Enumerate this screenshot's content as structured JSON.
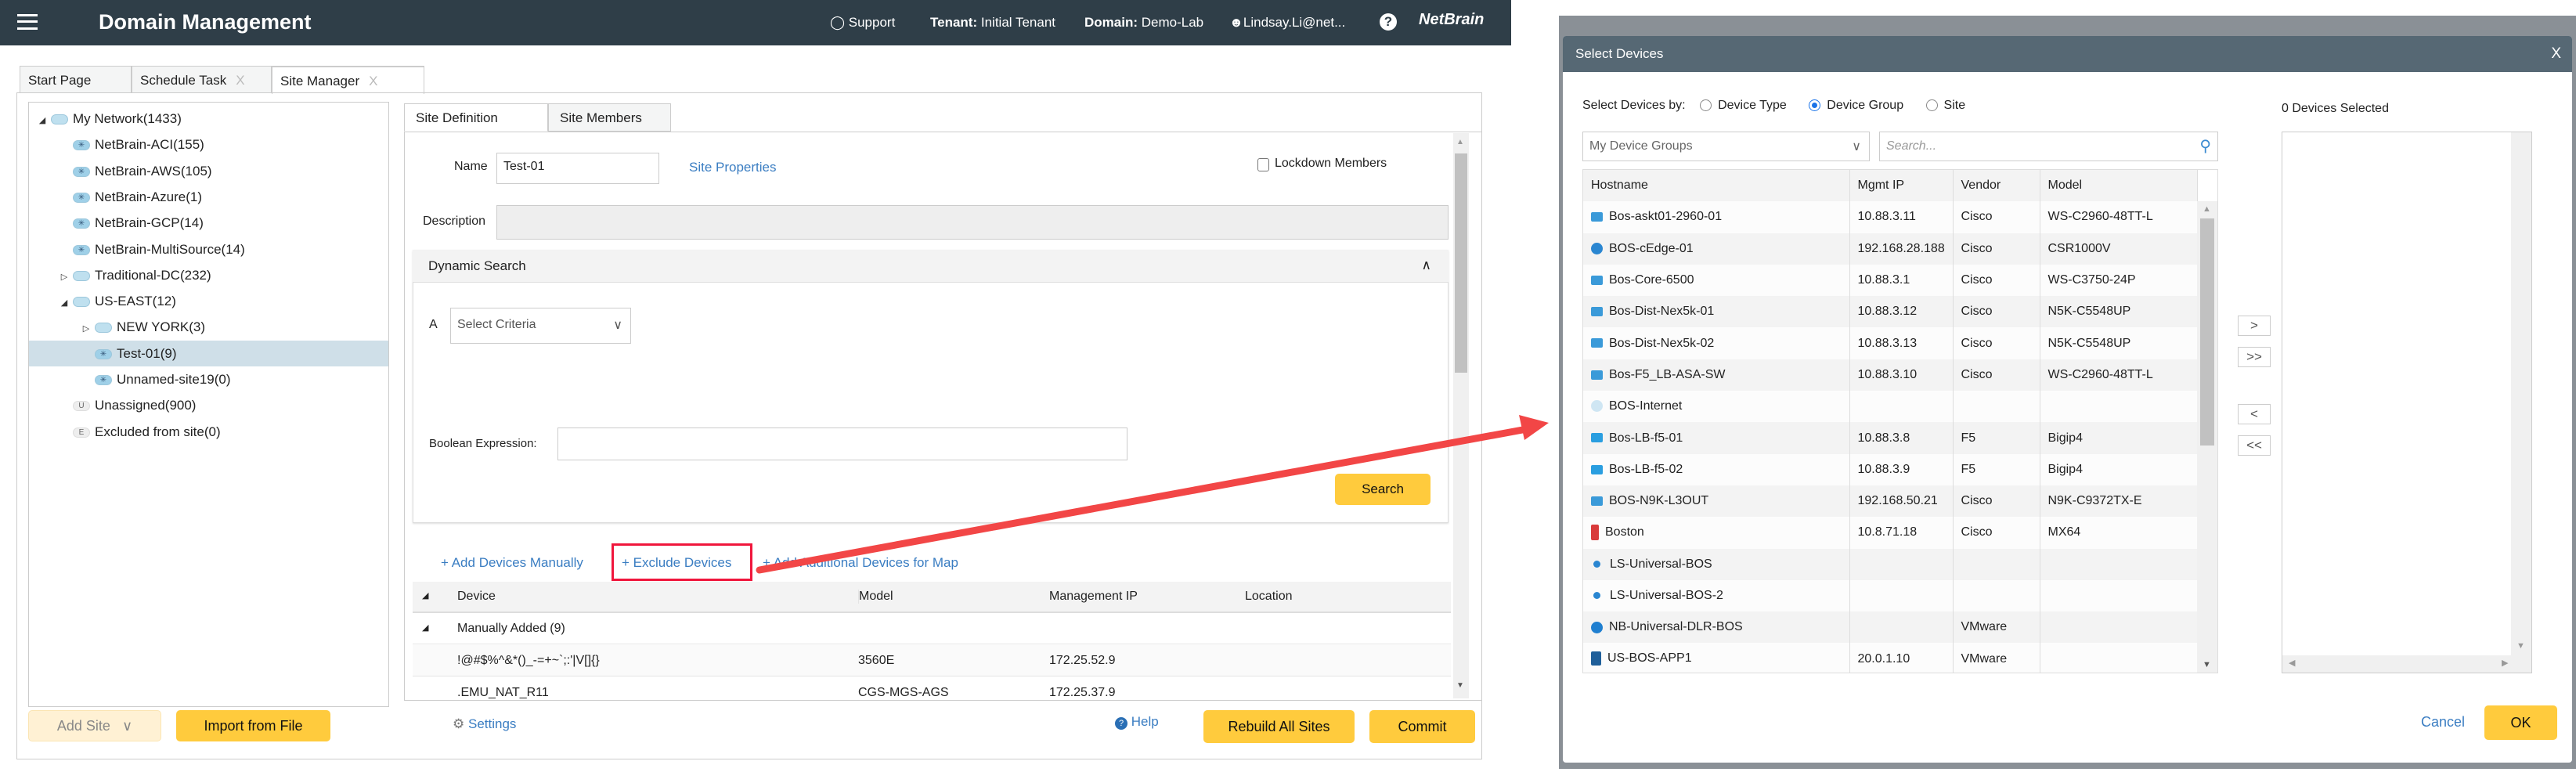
{
  "header": {
    "title": "Domain Management",
    "support": "Support",
    "tenant_label": "Tenant:",
    "tenant": "Initial Tenant",
    "domain_label": "Domain:",
    "domain": "Demo-Lab",
    "user": "Lindsay.Li@net...",
    "help": "?",
    "logo": "NetBrain"
  },
  "tabs": [
    {
      "label": "Start Page"
    },
    {
      "label": "Schedule Task",
      "close": "X"
    },
    {
      "label": "Site Manager",
      "close": "X",
      "active": true
    }
  ],
  "tree": [
    {
      "label": "My Network(1433)",
      "level": 0,
      "expander": "open",
      "icon": "cloud"
    },
    {
      "label": "NetBrain-ACI(155)",
      "level": 1,
      "expander": "none",
      "icon": "site"
    },
    {
      "label": "NetBrain-AWS(105)",
      "level": 1,
      "expander": "none",
      "icon": "site"
    },
    {
      "label": "NetBrain-Azure(1)",
      "level": 1,
      "expander": "none",
      "icon": "site"
    },
    {
      "label": "NetBrain-GCP(14)",
      "level": 1,
      "expander": "none",
      "icon": "site"
    },
    {
      "label": "NetBrain-MultiSource(14)",
      "level": 1,
      "expander": "none",
      "icon": "site"
    },
    {
      "label": "Traditional-DC(232)",
      "level": 1,
      "expander": "closed",
      "icon": "cloud"
    },
    {
      "label": "US-EAST(12)",
      "level": 1,
      "expander": "open",
      "icon": "cloud"
    },
    {
      "label": "NEW YORK(3)",
      "level": 2,
      "expander": "closed",
      "icon": "cloud"
    },
    {
      "label": "Test-01(9)",
      "level": 2,
      "expander": "none",
      "icon": "site",
      "selected": true
    },
    {
      "label": "Unnamed-site19(0)",
      "level": 2,
      "expander": "none",
      "icon": "site"
    },
    {
      "label": "Unassigned(900)",
      "level": 1,
      "expander": "none",
      "icon": "U"
    },
    {
      "label": "Excluded from site(0)",
      "level": 1,
      "expander": "none",
      "icon": "E"
    }
  ],
  "left_buttons": {
    "add_site": "Add Site",
    "import": "Import from File"
  },
  "site_tabs": {
    "definition": "Site Definition",
    "members": "Site Members"
  },
  "site_form": {
    "name_label": "Name",
    "name_value": "Test-01",
    "site_properties": "Site Properties",
    "lockdown": "Lockdown Members",
    "description_label": "Description",
    "description_value": "",
    "dynamic_search": "Dynamic Search",
    "criteria_letter": "A",
    "criteria_placeholder": "Select Criteria",
    "boolean_label": "Boolean Expression:",
    "boolean_value": "",
    "search": "Search"
  },
  "actions": {
    "add_manually": "Add Devices Manually",
    "exclude": "Exclude Devices",
    "add_additional": "Add Additional Devices for Map"
  },
  "members_grid": {
    "columns": [
      "Device",
      "Model",
      "Management IP",
      "Location"
    ],
    "group": "Manually Added (9)",
    "rows": [
      [
        "!@#$%^&*()_-=+~`;:'|V[]{}",
        "3560E",
        "172.25.52.9",
        ""
      ],
      [
        ".EMU_NAT_R11",
        "CGS-MGS-AGS",
        "172.25.37.9",
        ""
      ]
    ]
  },
  "footer": {
    "settings": "Settings",
    "help": "Help",
    "rebuild": "Rebuild All Sites",
    "commit": "Commit"
  },
  "modal": {
    "title": "Select Devices",
    "close": "X",
    "select_by_label": "Select Devices by:",
    "options": [
      {
        "label": "Device Type",
        "checked": false
      },
      {
        "label": "Device Group",
        "checked": true
      },
      {
        "label": "Site",
        "checked": false
      }
    ],
    "group_select": "My Device Groups",
    "search_placeholder": "Search...",
    "selected_count": "0 Devices Selected",
    "columns": [
      "Hostname",
      "Mgmt IP",
      "Vendor",
      "Model"
    ],
    "rows": [
      {
        "icon": "switch",
        "color": "#3a9ad9",
        "cells": [
          "Bos-askt01-2960-01",
          "10.88.3.11",
          "Cisco",
          "WS-C2960-48TT-L"
        ]
      },
      {
        "icon": "router",
        "color": "#2a86d1",
        "cells": [
          "BOS-cEdge-01",
          "192.168.28.188",
          "Cisco",
          "CSR1000V"
        ]
      },
      {
        "icon": "switch",
        "color": "#3a9ad9",
        "cells": [
          "Bos-Core-6500",
          "10.88.3.1",
          "Cisco",
          "WS-C3750-24P"
        ]
      },
      {
        "icon": "l3-switch",
        "color": "#3a9ad9",
        "cells": [
          "Bos-Dist-Nex5k-01",
          "10.88.3.12",
          "Cisco",
          "N5K-C5548UP"
        ]
      },
      {
        "icon": "l3-switch",
        "color": "#3a9ad9",
        "cells": [
          "Bos-Dist-Nex5k-02",
          "10.88.3.13",
          "Cisco",
          "N5K-C5548UP"
        ]
      },
      {
        "icon": "switch",
        "color": "#3a9ad9",
        "cells": [
          "Bos-F5_LB-ASA-SW",
          "10.88.3.10",
          "Cisco",
          "WS-C2960-48TT-L"
        ]
      },
      {
        "icon": "cloud",
        "color": "#cfe6f3",
        "cells": [
          "BOS-Internet",
          "",
          "",
          ""
        ]
      },
      {
        "icon": "load-balancer",
        "color": "#2a9ee0",
        "cells": [
          "Bos-LB-f5-01",
          "10.88.3.8",
          "F5",
          "Bigip4"
        ]
      },
      {
        "icon": "load-balancer",
        "color": "#2a9ee0",
        "cells": [
          "Bos-LB-f5-02",
          "10.88.3.9",
          "F5",
          "Bigip4"
        ]
      },
      {
        "icon": "l3-switch",
        "color": "#3a9ad9",
        "cells": [
          "BOS-N9K-L3OUT",
          "192.168.50.21",
          "Cisco",
          "N9K-C9372TX-E"
        ]
      },
      {
        "icon": "firewall",
        "color": "#d93a3a",
        "cells": [
          "Boston",
          "10.8.71.18",
          "Cisco",
          "MX64"
        ]
      },
      {
        "icon": "dot",
        "color": "#2a86d1",
        "cells": [
          "LS-Universal-BOS",
          "",
          "",
          ""
        ]
      },
      {
        "icon": "dot",
        "color": "#2a86d1",
        "cells": [
          "LS-Universal-BOS-2",
          "",
          "",
          ""
        ]
      },
      {
        "icon": "router",
        "color": "#1f7fd0",
        "cells": [
          "NB-Universal-DLR-BOS",
          "",
          "VMware",
          ""
        ]
      },
      {
        "icon": "server",
        "color": "#1f5f9a",
        "cells": [
          "US-BOS-APP1",
          "20.0.1.10",
          "VMware",
          ""
        ]
      }
    ],
    "move_buttons": {
      "add": ">",
      "add_all": ">>",
      "remove": "<",
      "remove_all": "<<"
    },
    "cancel": "Cancel",
    "ok": "OK"
  },
  "colors": {
    "topbar": "#2f3e48",
    "modal_header": "#566874",
    "accent_yellow": "#ffcb3d",
    "link": "#3a7dc2",
    "annotation_red": "#f0163c",
    "selected_row": "#cfdfe8"
  }
}
